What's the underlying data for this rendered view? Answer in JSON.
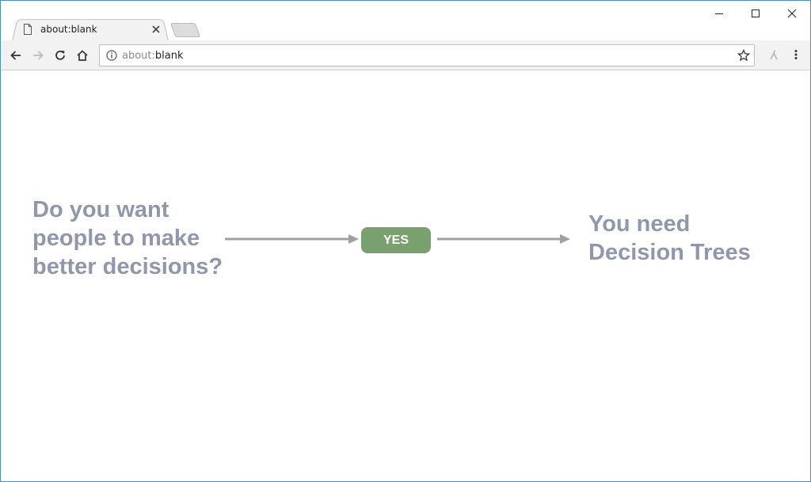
{
  "tab": {
    "title": "about:blank",
    "page_icon": "page-icon",
    "close_icon": "close-icon"
  },
  "window_controls": {
    "minimize_icon": "minimize-icon",
    "maximize_icon": "maximize-icon",
    "close_icon": "close-icon"
  },
  "toolbar": {
    "back_icon": "arrow-left-icon",
    "forward_icon": "arrow-right-icon",
    "reload_icon": "reload-icon",
    "home_icon": "home-icon",
    "url_prefix": "about:",
    "url_rest": "blank",
    "info_icon": "info-icon",
    "star_icon": "star-icon",
    "extension_icon": "extension-icon",
    "menu_icon": "kebab-menu-icon"
  },
  "diagram": {
    "question": "Do you want\npeople to make\nbetter decisions?",
    "decision_label": "YES",
    "answer": "You need\nDecision Trees"
  },
  "colors": {
    "text": "#9097aa",
    "badge": "#7aa06f",
    "arrow": "#a0a0a0",
    "window_border": "#4a90c8"
  }
}
